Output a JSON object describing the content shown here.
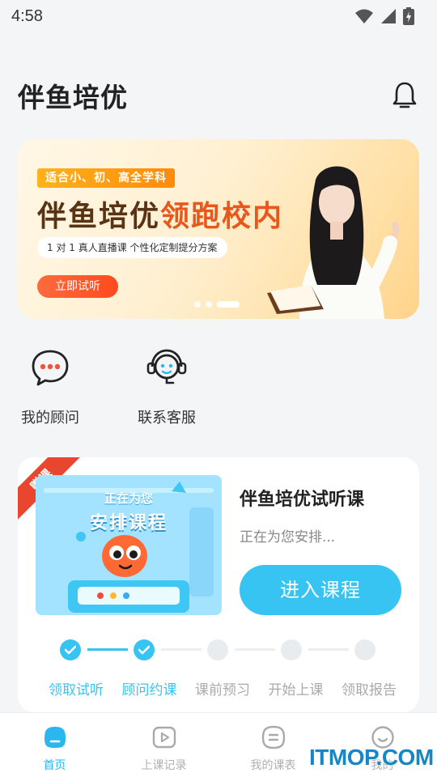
{
  "status_bar": {
    "time": "4:58",
    "icons": [
      "wifi-icon",
      "signal-icon",
      "battery-charging-icon"
    ]
  },
  "header": {
    "title": "伴鱼培优",
    "bell_icon": "bell-icon"
  },
  "banner": {
    "tag": "适合小、初、高全学科",
    "headline_main": "伴鱼培优",
    "headline_accent": "领跑校内",
    "subtitle": "1 对 1 真人直播课  个性化定制提分方案",
    "cta": "立即试听",
    "active_slide": 3,
    "slide_count": 3
  },
  "shortcuts": [
    {
      "label": "我的顾问",
      "icon": "chat-bubble-icon"
    },
    {
      "label": "联系客服",
      "icon": "headset-icon"
    }
  ],
  "course_card": {
    "ribbon": "赠课",
    "thumb_text_top": "正在为您",
    "thumb_text_main": "安排课程",
    "title": "伴鱼培优试听课",
    "status": "正在为您安排...",
    "enter_button": "进入课程",
    "steps": [
      {
        "label": "领取试听",
        "done": true
      },
      {
        "label": "顾问约课",
        "done": true
      },
      {
        "label": "课前预习",
        "done": false
      },
      {
        "label": "开始上课",
        "done": false
      },
      {
        "label": "领取报告",
        "done": false
      }
    ]
  },
  "tabbar": {
    "active": 0,
    "tabs": [
      {
        "label": "首页",
        "icon": "home-icon"
      },
      {
        "label": "上课记录",
        "icon": "play-record-icon"
      },
      {
        "label": "我的课表",
        "icon": "schedule-icon"
      },
      {
        "label": "我的",
        "icon": "smile-icon"
      }
    ]
  },
  "watermark": "ITMOP.COM",
  "colors": {
    "accent": "#37c4f2",
    "ribbon": "#e9462f",
    "cta": "#ff5527"
  }
}
